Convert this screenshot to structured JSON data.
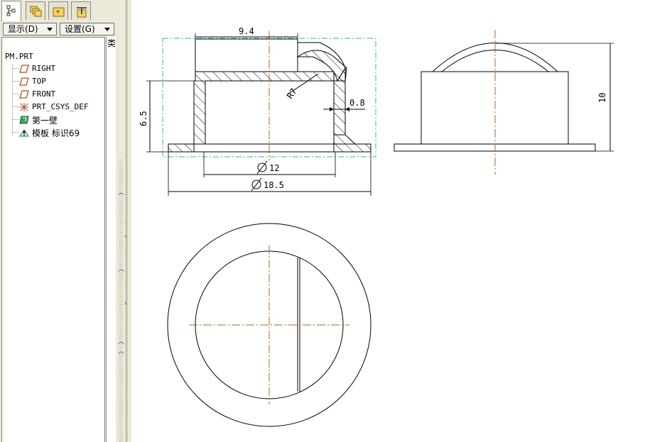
{
  "tabs": [
    {
      "name": "model-tree"
    },
    {
      "name": "layers"
    },
    {
      "name": "folder-browser"
    },
    {
      "name": "favorites"
    }
  ],
  "toolbar": {
    "display_label": "显示(D)",
    "settings_label": "设置(G)"
  },
  "side_label": "类",
  "tree": {
    "root": "PM.PRT",
    "items": [
      {
        "label": "RIGHT",
        "icon": "datum-plane-icon"
      },
      {
        "label": "TOP",
        "icon": "datum-plane-icon"
      },
      {
        "label": "FRONT",
        "icon": "datum-plane-icon"
      },
      {
        "label": "PRT_CSYS_DEF",
        "icon": "coordinate-system-icon"
      },
      {
        "label": "第一壁",
        "icon": "first-wall-icon"
      },
      {
        "label": "模板 标识69",
        "icon": "template-icon"
      }
    ]
  },
  "dimensions": {
    "top_width": "9.4",
    "height_left": "6.5",
    "radius": "R7",
    "wall_thickness": "0.8",
    "inner_diameter": "12",
    "outer_diameter": "18.5",
    "total_height": "10"
  },
  "colors": {
    "panel_bg": "#ece9d8",
    "centerline": "#b5651d",
    "bounding_box": "#29b6c9",
    "splitter_arrows": "#2c3fb8"
  }
}
